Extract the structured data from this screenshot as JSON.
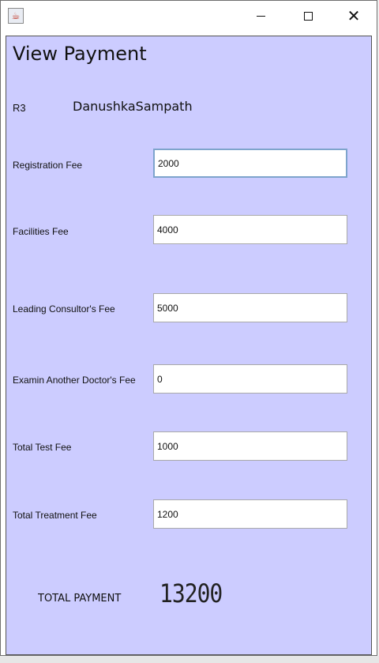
{
  "window": {
    "icon": "java-cup-icon",
    "controls": {
      "minimize": "minimize-icon",
      "maximize": "maximize-icon",
      "close": "close-icon"
    }
  },
  "page": {
    "title": "View Payment",
    "patient_id": "R3",
    "patient_name": "DanushkaSampath"
  },
  "fees": [
    {
      "label": "Registration Fee",
      "value": "2000"
    },
    {
      "label": "Facilities Fee",
      "value": "4000"
    },
    {
      "label": "Leading Consultor's Fee",
      "value": "5000"
    },
    {
      "label": "Examin Another Doctor's Fee",
      "value": "0"
    },
    {
      "label": "Total Test Fee",
      "value": "1000"
    },
    {
      "label": "Total Treatment Fee",
      "value": "1200"
    }
  ],
  "total": {
    "label": "TOTAL PAYMENT",
    "value": "13200"
  },
  "colors": {
    "panel_background": "#ccccff",
    "focus_border": "#7ea4cc"
  }
}
